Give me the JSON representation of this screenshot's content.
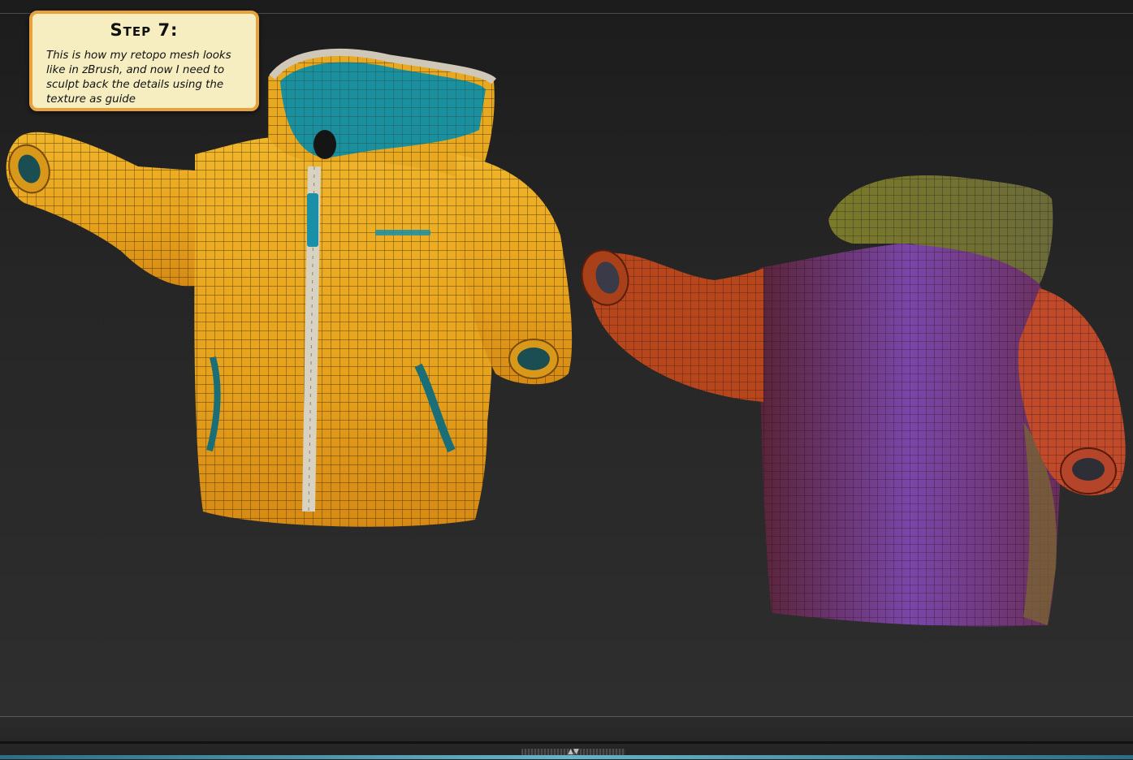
{
  "note": {
    "title": "Step 7:",
    "body": "This is how my retopo mesh looks like in zBrush, and now I need to sculpt back the details using the texture as guide"
  },
  "colors": {
    "note_background": "#f6eec0",
    "note_border": "#e8a23d",
    "jacket_yellow": "#e6a51f",
    "jacket_teal": "#1a8f9e",
    "polygroup_orange": "#b8461c",
    "polygroup_purple": "#6a3a8f",
    "polygroup_olive": "#8a8a2e",
    "viewport_background": "#262626"
  },
  "icons": {
    "tray_handle": "expand-arrows-icon"
  }
}
